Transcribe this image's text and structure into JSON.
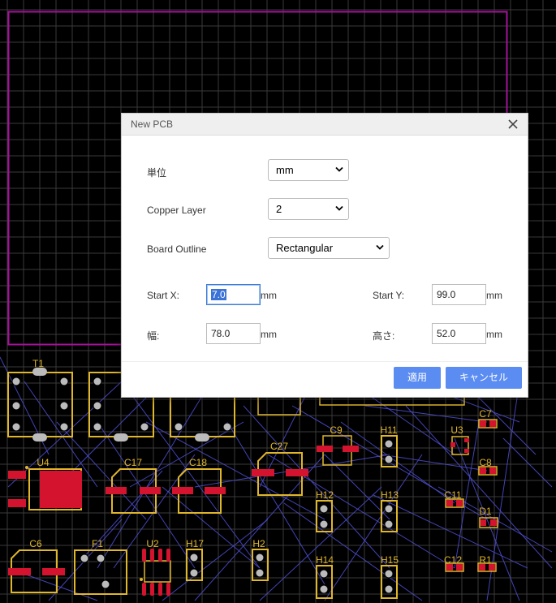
{
  "dialog": {
    "title": "New PCB",
    "fields": {
      "unit": {
        "label": "単位",
        "value": "mm"
      },
      "copper_layer": {
        "label": "Copper Layer",
        "value": "2"
      },
      "board_outline": {
        "label": "Board Outline",
        "value": "Rectangular"
      },
      "start_x": {
        "label": "Start X:",
        "value": "7.0",
        "unit": "mm"
      },
      "start_y": {
        "label": "Start Y:",
        "value": "99.0",
        "unit": "mm"
      },
      "width": {
        "label": "幅:",
        "value": "78.0",
        "unit": "mm"
      },
      "height": {
        "label": "高さ:",
        "value": "52.0",
        "unit": "mm"
      }
    },
    "buttons": {
      "apply": "適用",
      "cancel": "キャンセル"
    }
  },
  "pcb": {
    "designators": [
      "T1",
      "U4",
      "C17",
      "C18",
      "C27",
      "C9",
      "H11",
      "U3",
      "C7",
      "C8",
      "C11",
      "D1",
      "C6",
      "F1",
      "U2",
      "H17",
      "H2",
      "H12",
      "H13",
      "H14",
      "H15",
      "C12",
      "R1"
    ],
    "colors": {
      "background": "#000000",
      "grid": "#3a3a3a",
      "outline": "#a4129a",
      "silkscreen": "#e0b62a",
      "pad": "#d4142e",
      "ratsnest": "#4f4fd6",
      "via": "#bdbdbd"
    }
  }
}
